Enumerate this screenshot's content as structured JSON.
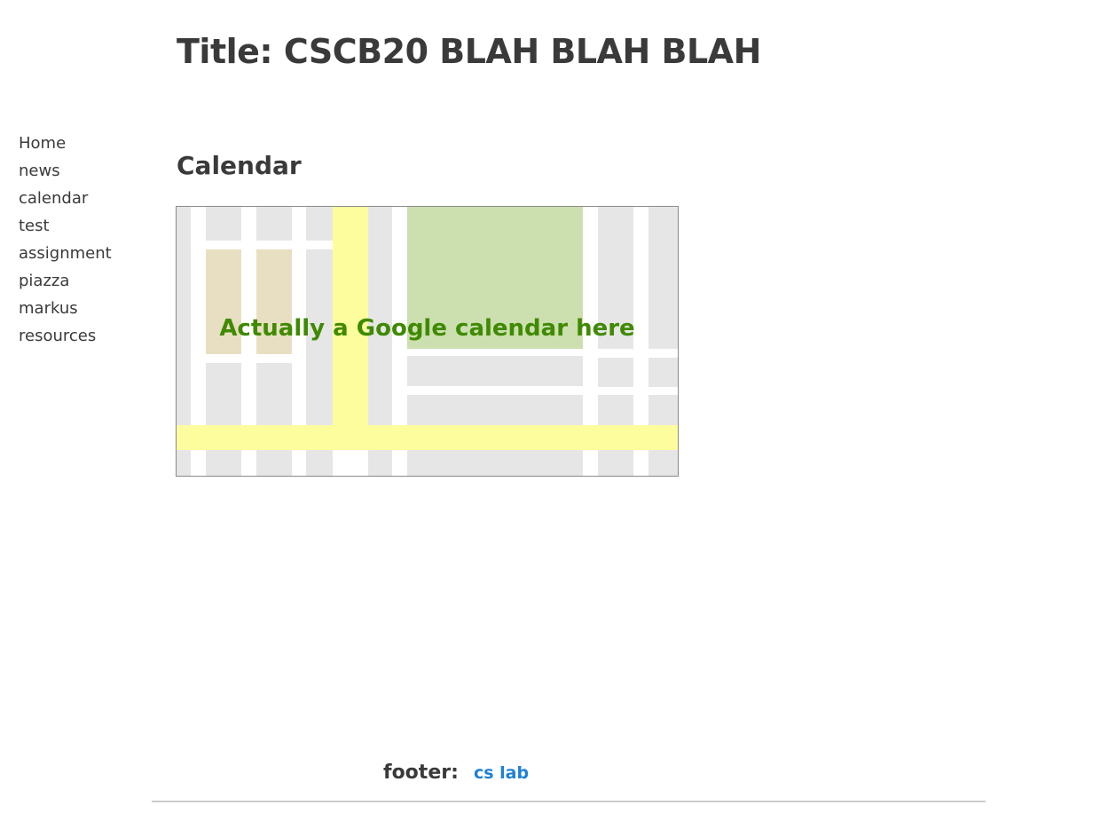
{
  "header": {
    "title": "Title: CSCB20 BLAH BLAH BLAH"
  },
  "sidebar": {
    "items": [
      {
        "label": "Home"
      },
      {
        "label": "news"
      },
      {
        "label": "calendar"
      },
      {
        "label": "test"
      },
      {
        "label": "assignment"
      },
      {
        "label": "piazza"
      },
      {
        "label": "markus"
      },
      {
        "label": "resources"
      }
    ]
  },
  "main": {
    "heading": "Calendar",
    "calendar_placeholder": "Actually a Google calendar here"
  },
  "footer": {
    "label": "footer:",
    "link_label": "cs lab"
  },
  "colors": {
    "text": "#3a3a3a",
    "link": "#1e80d6",
    "caption": "#3f8a00",
    "map_block": "#e7e6e6",
    "map_road_yellow": "#fefd9e",
    "map_park": "#cbdfaf",
    "map_building": "#e8dfc2"
  }
}
